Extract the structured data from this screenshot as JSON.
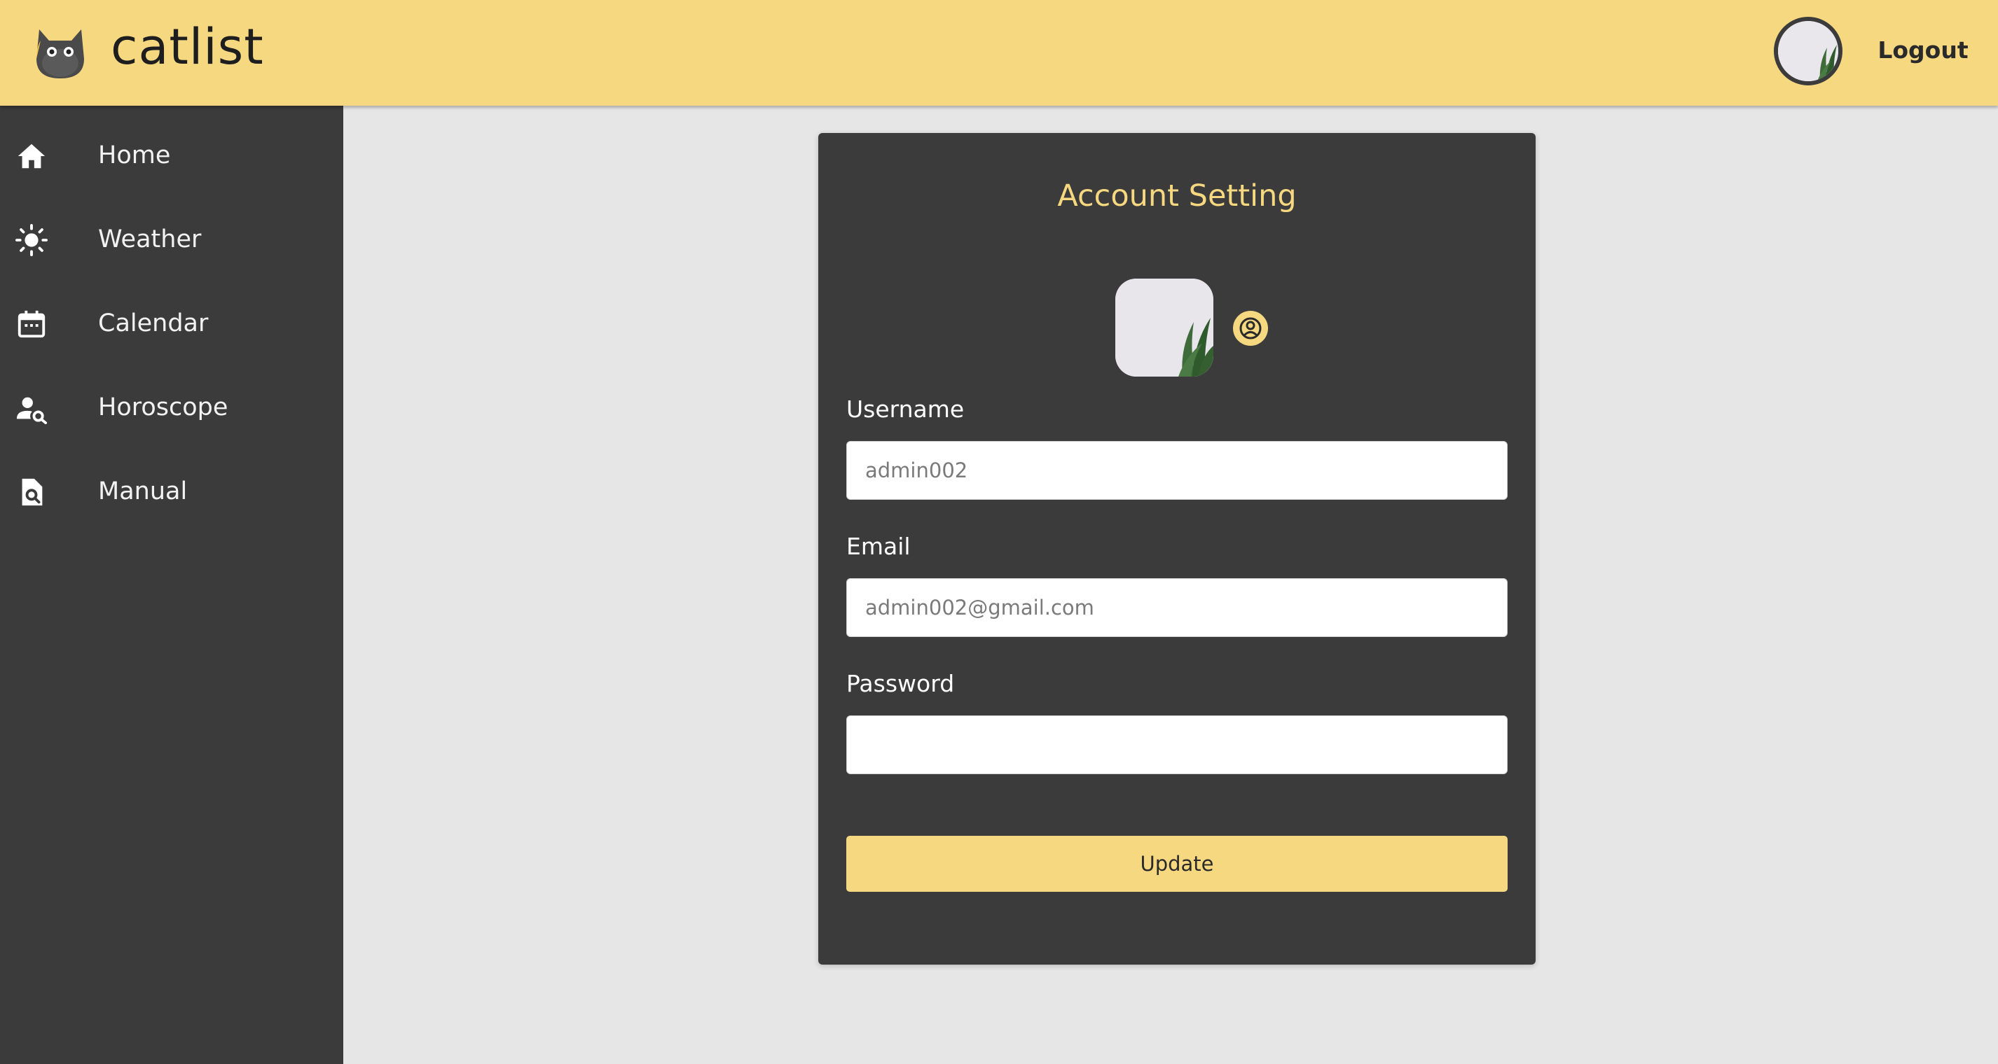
{
  "header": {
    "brand": "catlist",
    "logo_icon": "cat-logo-icon",
    "avatar_icon": "plant-avatar-image",
    "logout_label": "Logout"
  },
  "sidebar": {
    "items": [
      {
        "label": "Home",
        "icon": "home-icon"
      },
      {
        "label": "Weather",
        "icon": "sun-icon"
      },
      {
        "label": "Calendar",
        "icon": "calendar-icon"
      },
      {
        "label": "Horoscope",
        "icon": "person-search-icon"
      },
      {
        "label": "Manual",
        "icon": "document-search-icon"
      }
    ]
  },
  "account": {
    "title": "Account Setting",
    "profile_image_icon": "plant-profile-image",
    "edit_icon": "account-circle-icon",
    "username": {
      "label": "Username",
      "placeholder": "admin002"
    },
    "email": {
      "label": "Email",
      "placeholder": "admin002@gmail.com"
    },
    "password": {
      "label": "Password",
      "placeholder": ""
    },
    "update_label": "Update"
  },
  "colors": {
    "accent": "#f6d881",
    "dark": "#3b3b3b",
    "background": "#e6e6e6"
  }
}
